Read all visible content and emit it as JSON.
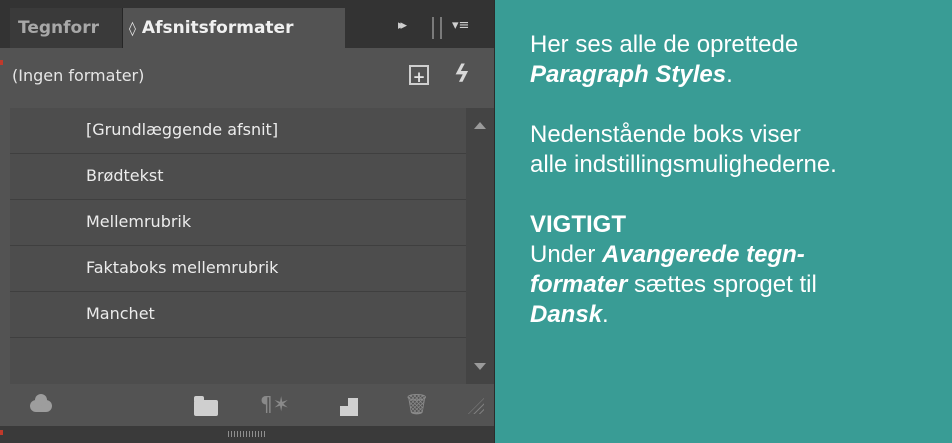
{
  "panel": {
    "tabs": {
      "inactive": "Tegnforr",
      "active_arrows": "◊",
      "active": "Afsnitsformater"
    },
    "icons": [
      "fast-forward-icon",
      "separator-icon",
      "panel-menu-icon",
      "new-style-override-icon",
      "clear-overrides-icon",
      "cloud-icon",
      "folder-icon",
      "pilcrow-icon",
      "new-style-icon",
      "trash-icon",
      "resize-grip-icon"
    ],
    "current_style": "(Ingen formater)",
    "styles": [
      "[Grundlæggende afsnit]",
      "Brødtekst",
      "Mellemrubrik",
      "Faktaboks mellemrubrik",
      "Manchet"
    ],
    "symbols": {
      "fast_forward": "▸▸",
      "menu": "▾≡",
      "new_override": "+",
      "clear_override": "ϟ",
      "pilcrow": "¶✶",
      "trash": "🗑"
    }
  },
  "note": {
    "line1_a": "Her ses alle de oprettede",
    "line1_em": "Paragraph Styles",
    "line1_end": ".",
    "line2": "Nedenstående boks viser",
    "line3": "alle indstillingsmulighederne.",
    "heading": "VIGTIGT",
    "line4_a": "Under ",
    "line4_em": "Avangerede tegn-",
    "line5_em": "formater",
    "line5_b": " sættes sproget til",
    "line6_em": "Dansk",
    "line6_end": "."
  },
  "colors": {
    "background_teal": "#399c95",
    "panel_gray": "#535353",
    "tab_bar": "#333333"
  }
}
